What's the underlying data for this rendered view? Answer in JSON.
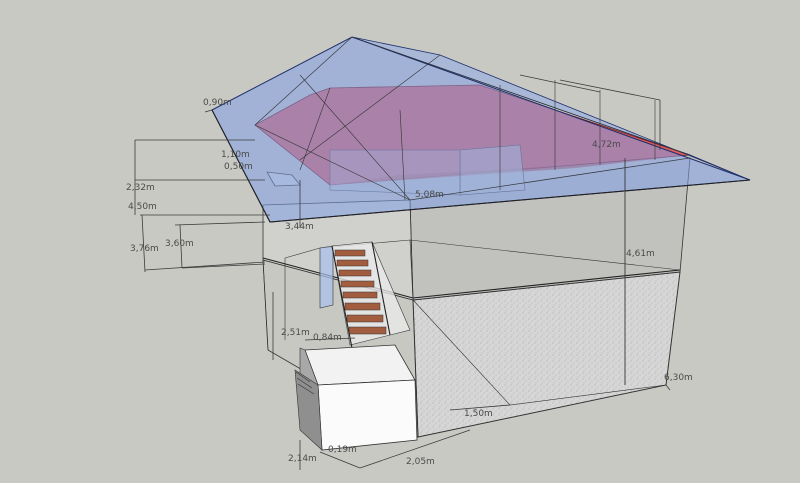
{
  "scene": {
    "colors": {
      "background": "#c9c9c4",
      "roof_glass": "#7f9ee6",
      "roof_red": "#e0474a",
      "wall_translucent": "#bdbdbd",
      "concrete": "#d4d4d4",
      "stair_wood": "#a25d3f",
      "white_box": "#fbfbfb"
    },
    "dimensions": [
      {
        "id": "d-090",
        "label": "0,90m"
      },
      {
        "id": "d-110",
        "label": "1,10m"
      },
      {
        "id": "d-050",
        "label": "0,50m"
      },
      {
        "id": "d-232",
        "label": "2,32m"
      },
      {
        "id": "d-450",
        "label": "4,50m"
      },
      {
        "id": "d-376",
        "label": "3,76m"
      },
      {
        "id": "d-360",
        "label": "3,60m"
      },
      {
        "id": "d-344",
        "label": "3,44m"
      },
      {
        "id": "d-508",
        "label": "5,08m"
      },
      {
        "id": "d-472",
        "label": "4,72m"
      },
      {
        "id": "d-461",
        "label": "4,61m"
      },
      {
        "id": "d-251",
        "label": "2,51m"
      },
      {
        "id": "d-084",
        "label": "0,84m"
      },
      {
        "id": "d-630",
        "label": "6,30m"
      },
      {
        "id": "d-150",
        "label": "1,50m"
      },
      {
        "id": "d-214",
        "label": "2,14m"
      },
      {
        "id": "d-019",
        "label": "0,19m"
      },
      {
        "id": "d-205",
        "label": "2,05m"
      }
    ]
  }
}
